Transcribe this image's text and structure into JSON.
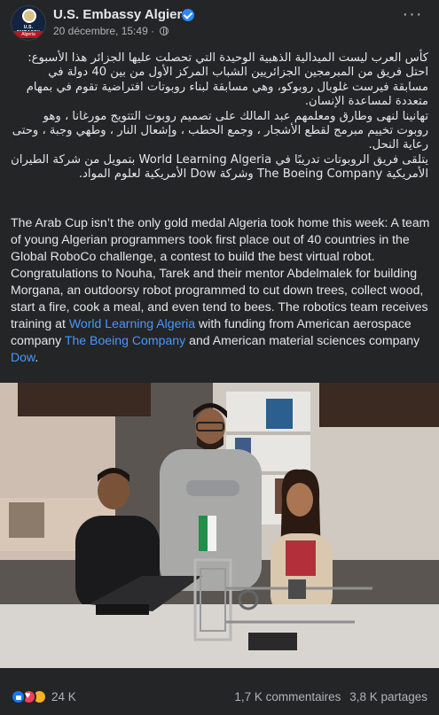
{
  "header": {
    "page_name": "U.S. Embassy Algiers",
    "date": "20 décembre, 15:49",
    "separator": "·",
    "more_icon": "more-horizontal-icon",
    "avatar": {
      "line1": "U.S. EMBASSY",
      "line2": "Algeria"
    }
  },
  "post": {
    "arabic_paragraphs": [
      "كأس العرب ليست الميدالية الذهبية الوحيدة التي تحصلت عليها الجزائر هذا الأسبوع: احتل فريق من المبرمجين الجزائريين الشباب المركز الأول من بين 40 دولة في مسابقة فيرست غلوبال روبوكو، وهي مسابقة لبناء روبوتات افتراضية تقوم في بمهام متعددة لمساعدة الإنسان.",
      "تهانينا لنهى وطارق ومعلمهم عبد المالك على تصميم  روبوت التتويج مورغانا ، وهو روبوت تخييم  مبرمج لقطع الأشجار ، وجمع الحطب ، وإشعال النار ، وطهي وجبة ، وحتى رعاية النحل.",
      "يتلقى فريق الروبوتات تدريبًا في World Learning Algeria بتمويل من شركة الطيران الأمريكية The Boeing Company وشركة Dow الأمريكية لعلوم المواد."
    ],
    "english_text_1": "The Arab Cup isn’t the only gold medal Algeria took home this week: A team of young Algerian programmers took first place out of 40 countries in the Global RoboCo challenge, a contest to build the best virtual robot. Congratulations to Nouha, Tarek and their mentor Abdelmalek for building Morgana, an outdoorsy robot programmed to cut down trees, collect wood, start a fire, cook a meal, and even tend to bees. The robotics team receives training at ",
    "link_world_learning": "World Learning Algeria",
    "english_text_2": "  with funding from American aerospace company ",
    "link_boeing": "The Boeing Company",
    "english_text_3": "  and American material sciences company ",
    "link_dow": "Dow",
    "english_text_4": "."
  },
  "footer": {
    "reaction_count": "24 K",
    "comments": "1,7 K commentaires",
    "shares": "3,8 K partages"
  },
  "colors": {
    "background": "#242526",
    "text": "#e4e6eb",
    "secondary_text": "#b0b3b8",
    "link": "#4599ff",
    "verified": "#2d88ff"
  }
}
